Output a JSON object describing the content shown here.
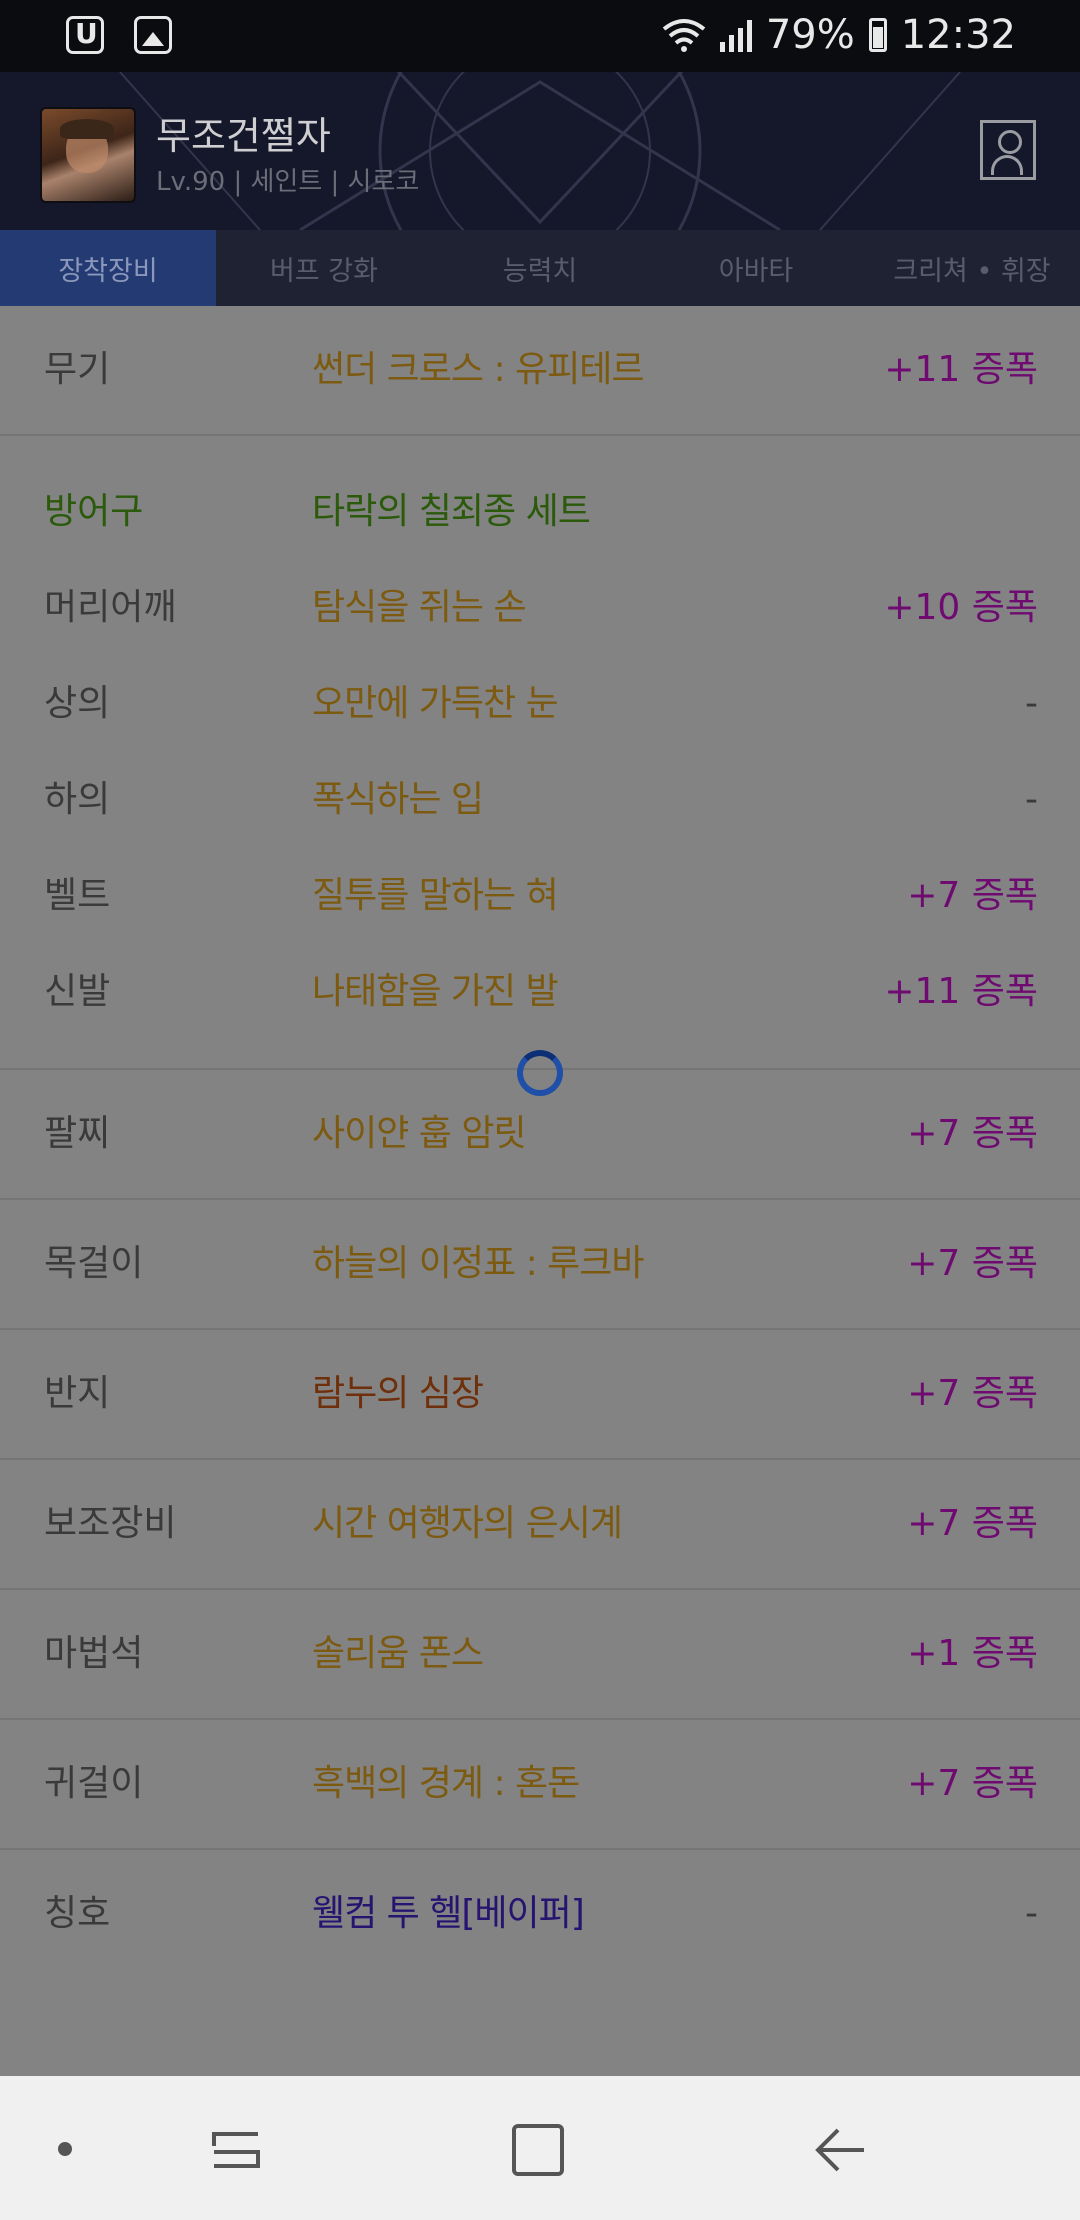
{
  "status_bar": {
    "battery_percent": "79%",
    "time": "12:32",
    "left_icons": [
      "u-plus-app-icon",
      "gallery-icon"
    ],
    "right_icons": [
      "wifi-icon",
      "signal-icon",
      "battery-icon"
    ]
  },
  "header": {
    "character_name": "무조건쩔자",
    "character_meta": "Lv.90 | 세인트 | 시로코"
  },
  "tabs": [
    {
      "label": "장착장비",
      "active": true
    },
    {
      "label": "버프 강화",
      "active": false
    },
    {
      "label": "능력치",
      "active": false
    },
    {
      "label": "아바타",
      "active": false
    },
    {
      "label": "크리쳐 • 휘장",
      "active": false
    }
  ],
  "equipment": {
    "weapon": {
      "slot": "무기",
      "name": "썬더 크로스 : 유피테르",
      "amp": "+11 증폭"
    },
    "armor": {
      "slot": "방어구",
      "set_name": "타락의 칠죄종 세트",
      "items": [
        {
          "slot": "머리어깨",
          "name": "탐식을 쥐는 손",
          "amp": "+10 증폭"
        },
        {
          "slot": "상의",
          "name": "오만에 가득찬 눈",
          "amp": "-"
        },
        {
          "slot": "하의",
          "name": "폭식하는 입",
          "amp": "-"
        },
        {
          "slot": "벨트",
          "name": "질투를 말하는 혀",
          "amp": "+7 증폭"
        },
        {
          "slot": "신발",
          "name": "나태함을 가진 발",
          "amp": "+11 증폭"
        }
      ]
    },
    "others": [
      {
        "slot": "팔찌",
        "name": "사이얀 훕 암릿",
        "amp": "+7 증폭"
      },
      {
        "slot": "목걸이",
        "name": "하늘의 이정표 : 루크바",
        "amp": "+7 증폭"
      },
      {
        "slot": "반지",
        "name": "람누의 심장",
        "amp": "+7 증폭",
        "color": "#6e2f0a"
      },
      {
        "slot": "보조장비",
        "name": "시간 여행자의 은시계",
        "amp": "+7 증폭"
      },
      {
        "slot": "마법석",
        "name": "솔리움 폰스",
        "amp": "+1 증폭"
      },
      {
        "slot": "귀걸이",
        "name": "흑백의 경계 : 혼돈",
        "amp": "+7 증폭"
      },
      {
        "slot": "칭호",
        "name": "웰컴 투 헬[베이퍼]",
        "amp": "-",
        "color": "#261470"
      }
    ]
  },
  "nav_bar": {
    "buttons": [
      "dot-icon",
      "recent-apps-icon",
      "home-icon",
      "back-icon"
    ]
  }
}
